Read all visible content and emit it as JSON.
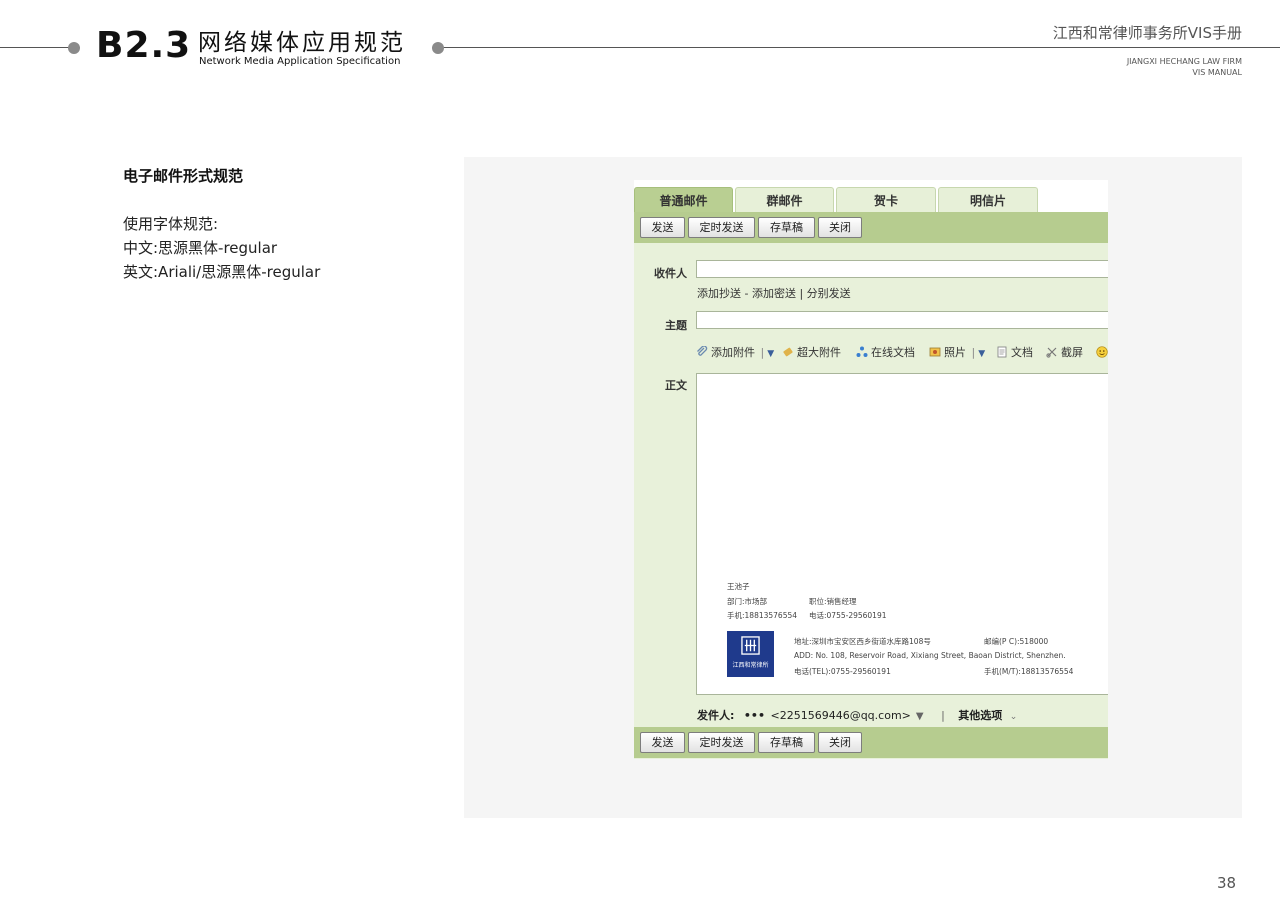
{
  "header": {
    "section_number": "B2.3",
    "section_title_cn": "网络媒体应用规范",
    "section_title_en": "Network Media Application Specification",
    "brand_cn": "江西和常律师事务所VIS手册",
    "brand_en_line1": "JIANGXI HECHANG LAW FIRM",
    "brand_en_line2": "VIS MANUAL"
  },
  "spec": {
    "heading": "电子邮件形式规范",
    "font_rule": "使用字体规范:",
    "chinese_font": "中文:思源黑体-regular",
    "english_font": "英文:Ariali/思源黑体-regular"
  },
  "mail": {
    "tabs": [
      {
        "label": "普通邮件",
        "active": true
      },
      {
        "label": "群邮件",
        "active": false
      },
      {
        "label": "贺卡",
        "active": false
      },
      {
        "label": "明信片",
        "active": false
      }
    ],
    "toolbar": {
      "send": "发送",
      "scheduled_send": "定时发送",
      "save_draft": "存草稿",
      "close": "关闭"
    },
    "fields": {
      "recipient_label": "收件人",
      "recipient_value": "",
      "cc_links": "添加抄送 - 添加密送 | 分别发送",
      "subject_label": "主题",
      "subject_value": "",
      "body_label": "正文"
    },
    "attachments": {
      "add_attachment": "添加附件",
      "large_attachment": "超大附件",
      "online_document": "在线文档",
      "photo": "照片",
      "document": "文档",
      "screenshot": "截屏"
    },
    "signature": {
      "name": "王池子",
      "department": "部门:市场部",
      "position": "职位:销售经理",
      "mobile": "手机:18813576554",
      "phone": "电话:0755-29560191",
      "address_cn": "地址:深圳市宝安区西乡街道水库路108号",
      "postcode": "邮编(P C):518000",
      "address_en": "ADD: No. 108, Reservoir Road, Xixiang Street, Baoan District, Shenzhen.",
      "tel": "电话(TEL):0755-29560191",
      "mobile_en": "手机(M/T):18813576554",
      "logo_text": "江西和常律所"
    },
    "sender": {
      "label": "发件人:",
      "value": "<2251569446@qq.com>",
      "other_options": "其他选项"
    }
  },
  "colors": {
    "toolbar_green": "#b6cc8f",
    "form_green": "#e8f1da",
    "logo_blue": "#1f3a8c",
    "panel_grey": "#f5f5f5"
  },
  "page_number": "38"
}
